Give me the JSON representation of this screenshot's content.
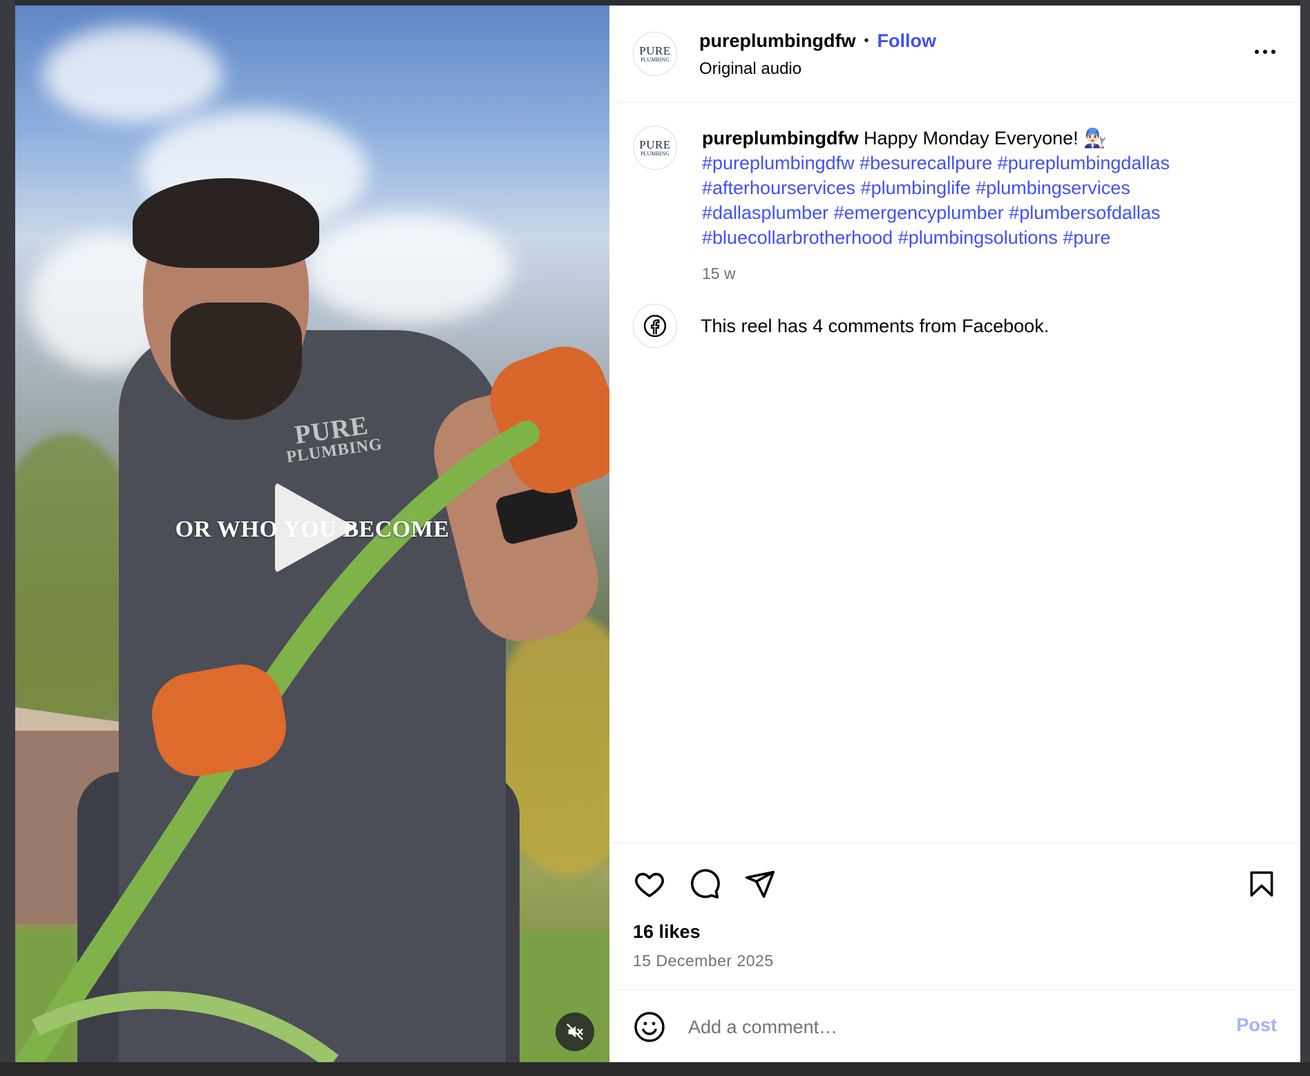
{
  "post": {
    "username": "pureplumbingdfw",
    "follow_label": "Follow",
    "separator": "•",
    "audio_label": "Original audio",
    "avatar_line1": "PURE",
    "avatar_line2": "PLUMBING"
  },
  "media": {
    "overlay_caption": "OR WHO YOU BECOME",
    "shirt_logo_line1": "PURE",
    "shirt_logo_line2": "PLUMBING"
  },
  "caption": {
    "username": "pureplumbingdfw",
    "text": " Happy Monday Everyone! 👨🏻‍🔧",
    "hashtags": "#pureplumbingdfw #besurecallpure #pureplumbingdallas #afterhourservices #plumbinglife #plumbingservices #dallasplumber #emergencyplumber #plumbersofdallas #bluecollarbrotherhood #plumbingsolutions #pure",
    "time_ago": "15 w"
  },
  "facebook": {
    "text": "This reel has 4 comments from Facebook."
  },
  "stats": {
    "likes": "16 likes",
    "date": "15 December 2025"
  },
  "comment": {
    "placeholder": "Add a comment…",
    "post_label": "Post"
  },
  "icons": {
    "like": "heart-icon",
    "comment": "comment-icon",
    "share": "share-icon",
    "save": "bookmark-icon",
    "emoji": "emoji-icon",
    "mute": "muted-speaker-icon",
    "play": "play-icon",
    "facebook": "facebook-icon",
    "more": "more-options-icon"
  },
  "colors": {
    "link": "#4150f7",
    "post_disabled": "#a7b0fb",
    "secondary_text": "#737373"
  }
}
